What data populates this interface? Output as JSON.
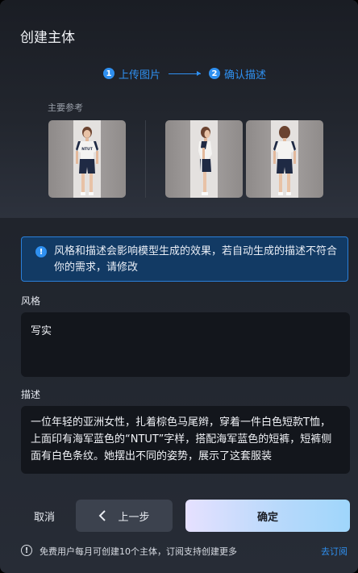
{
  "dialog": {
    "title": "创建主体",
    "steps": [
      {
        "number": "1",
        "label": "上传图片"
      },
      {
        "number": "2",
        "label": "确认描述"
      }
    ],
    "reference_label": "主要参考",
    "thumbnails": [
      "front-view",
      "side-view",
      "back-view"
    ],
    "banner": {
      "icon": "info-icon",
      "text": "风格和描述会影响模型生成的效果，若自动生成的描述不符合你的需求，请修改"
    },
    "style": {
      "label": "风格",
      "value": "写实"
    },
    "description": {
      "label": "描述",
      "value": "一位年轻的亚洲女性，扎着棕色马尾辫，穿着一件白色短款T恤，上面印有海军蓝色的“NTUT”字样，搭配海军蓝色的短裤，短裤侧面有白色条纹。她摆出不同的姿势，展示了这套服装"
    },
    "buttons": {
      "cancel": "取消",
      "prev": "上一步",
      "confirm": "确定"
    },
    "footer": {
      "icon": "alert-icon",
      "text": "免费用户每月可创建10个主体，订阅支持创建更多",
      "link": "去订阅"
    },
    "shirt_print": "NTUT",
    "colors": {
      "accent": "#2f90f0",
      "banner_bg": "#123a64",
      "field_bg": "#13161c"
    }
  }
}
